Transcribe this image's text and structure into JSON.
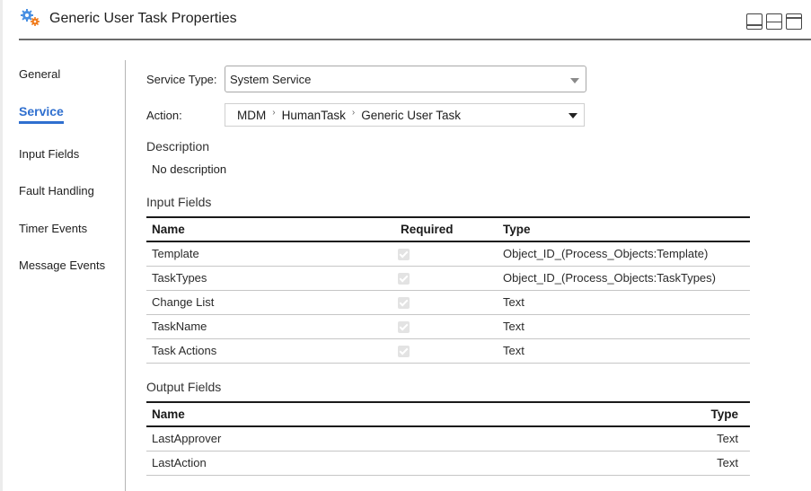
{
  "header": {
    "icon": "gears-icon",
    "title": "Generic User Task Properties",
    "layout_buttons": [
      {
        "name": "layout-bottom-panel-button",
        "icon": "panel-bottom-icon"
      },
      {
        "name": "layout-split-panel-button",
        "icon": "panel-split-icon"
      },
      {
        "name": "layout-top-panel-button",
        "icon": "panel-top-icon"
      }
    ]
  },
  "sidebar": {
    "items": [
      {
        "label": "General",
        "active": false
      },
      {
        "label": "Service",
        "active": true
      },
      {
        "label": "Input Fields",
        "active": false
      },
      {
        "label": "Fault Handling",
        "active": false
      },
      {
        "label": "Timer Events",
        "active": false
      },
      {
        "label": "Message Events",
        "active": false
      }
    ]
  },
  "form": {
    "service_type": {
      "label": "Service Type:",
      "value": "System Service"
    },
    "action": {
      "label": "Action:",
      "path": [
        "MDM",
        "HumanTask",
        "Generic User Task"
      ],
      "separator": "›"
    }
  },
  "description": {
    "title": "Description",
    "text": "No description"
  },
  "input_fields": {
    "title": "Input Fields",
    "columns": [
      "Name",
      "Required",
      "Type"
    ],
    "rows": [
      {
        "name": "Template",
        "required": true,
        "type": "Object_ID_(Process_Objects:Template)"
      },
      {
        "name": "TaskTypes",
        "required": true,
        "type": "Object_ID_(Process_Objects:TaskTypes)"
      },
      {
        "name": "Change List",
        "required": true,
        "type": "Text"
      },
      {
        "name": "TaskName",
        "required": true,
        "type": "Text"
      },
      {
        "name": "Task Actions",
        "required": true,
        "type": "Text"
      }
    ]
  },
  "output_fields": {
    "title": "Output Fields",
    "columns": [
      "Name",
      "Type"
    ],
    "rows": [
      {
        "name": "LastApprover",
        "type": "Text"
      },
      {
        "name": "LastAction",
        "type": "Text"
      }
    ]
  },
  "colors": {
    "accent": "#2f6fcf",
    "gear_blue": "#4a90e2",
    "gear_orange": "#f07a1a"
  }
}
